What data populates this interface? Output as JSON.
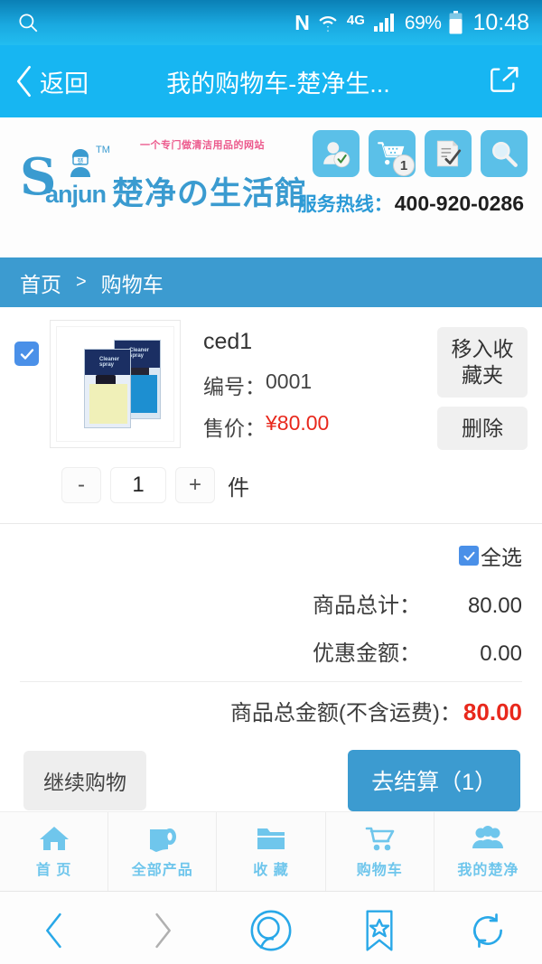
{
  "statusbar": {
    "search_icon": "search-icon",
    "nfc_label": "N",
    "network_label": "4G",
    "battery_percent": "69%",
    "time": "10:48"
  },
  "titlebar": {
    "back_label": "返回",
    "title": "我的购物车-楚净生...",
    "share_icon": "share-icon"
  },
  "siteheader": {
    "logo_s": "S",
    "logo_anjun": "anjun",
    "logo_tm": "TM",
    "logo_text": "楚净の生活館",
    "tagline": "一个专门做清洁用品的网站",
    "icons": [
      {
        "name": "user-check-icon"
      },
      {
        "name": "cart-icon",
        "badge": "1"
      },
      {
        "name": "order-edit-icon"
      },
      {
        "name": "search-icon"
      }
    ],
    "hotline_label": "服务热线：",
    "hotline_number": "400-920-0286"
  },
  "breadcrumb": {
    "home": "首页",
    "separator": ">",
    "current": "购物车"
  },
  "cart": {
    "item": {
      "checked": true,
      "name": "ced1",
      "sku_label": "编号：",
      "sku_value": "0001",
      "price_label": "售价：",
      "price_value": "¥80.00",
      "move_to_favorites": "移入收藏夹",
      "delete": "删除",
      "qty_minus": "-",
      "qty_value": "1",
      "qty_plus": "+",
      "qty_unit": "件",
      "thumb_pack_text": "Cleaner spray"
    },
    "summary": {
      "select_all_label": "全选",
      "select_all_checked": true,
      "subtotal_label": "商品总计：",
      "subtotal_value": "80.00",
      "discount_label": "优惠金额：",
      "discount_value": "0.00",
      "total_label": "商品总金额(不含运费)：",
      "total_value": "80.00"
    },
    "actions": {
      "continue_shopping": "继续购物",
      "checkout": "去结算（1）"
    }
  },
  "tabbar": [
    {
      "label": "首 页",
      "icon": "home-icon"
    },
    {
      "label": "全部产品",
      "icon": "paper-roll-icon"
    },
    {
      "label": "收 藏",
      "icon": "folder-icon"
    },
    {
      "label": "购物车",
      "icon": "cart-icon"
    },
    {
      "label": "我的楚净",
      "icon": "people-icon"
    }
  ],
  "browsernav": [
    {
      "name": "back-icon"
    },
    {
      "name": "forward-icon"
    },
    {
      "name": "browse-icon"
    },
    {
      "name": "bookmark-icon"
    },
    {
      "name": "refresh-icon"
    }
  ],
  "colors": {
    "accent_blue": "#17b6f2",
    "breadcrumb_blue": "#3c9bd0",
    "price_red": "#e8281c",
    "checkbox_blue": "#4a90e8",
    "tab_blue": "#6fc6ec"
  }
}
